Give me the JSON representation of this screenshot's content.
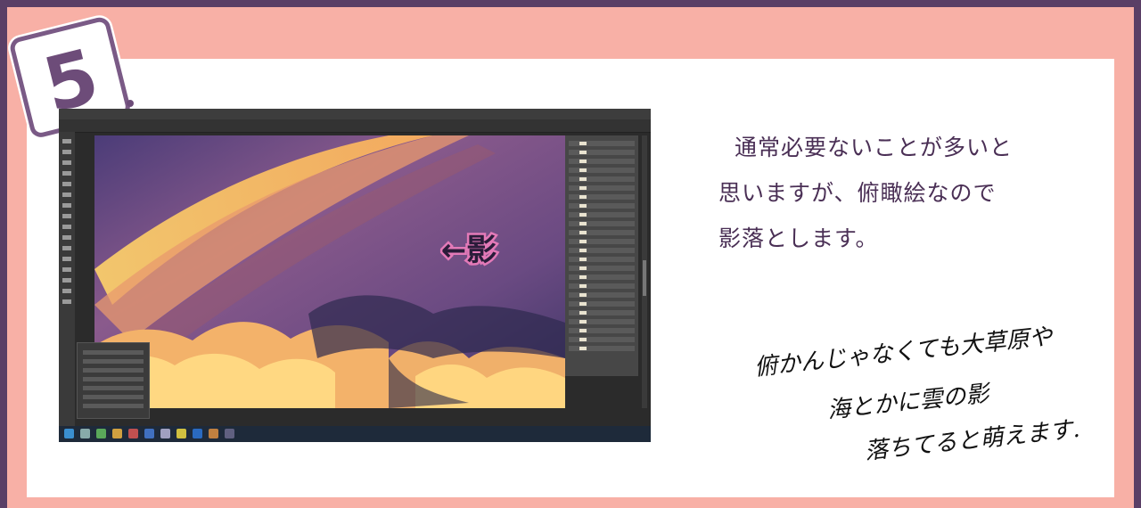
{
  "badge": {
    "number": "5"
  },
  "screenshot": {
    "arrow_annotation": "←影"
  },
  "description": {
    "lines": [
      "通常必要ないことが多いと",
      "思いますが、俯瞰絵なので",
      "影落とします。"
    ]
  },
  "handwritten_note": {
    "lines": [
      "俯かんじゃなくても大草原や",
      "海とかに雲の影",
      "落ちてると萌えます."
    ]
  },
  "colors": {
    "frame_outer": "#5a3f66",
    "frame_inner": "#f8b0a6",
    "card": "#ffffff",
    "text": "#4a2f55",
    "annotation_glow": "#e37ab8"
  },
  "icons": [
    "number-badge-icon",
    "arrow-left-icon"
  ]
}
